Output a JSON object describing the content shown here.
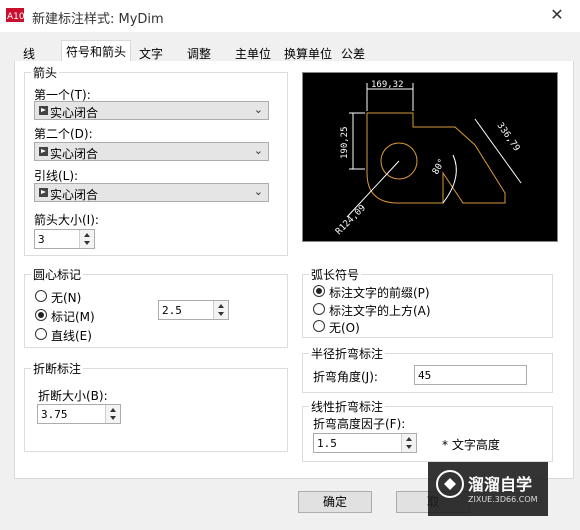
{
  "window": {
    "title": "新建标注样式: MyDim",
    "app_icon_label": "A10"
  },
  "tabs": [
    {
      "label": "线"
    },
    {
      "label": "符号和箭头"
    },
    {
      "label": "文字"
    },
    {
      "label": "调整"
    },
    {
      "label": "主单位"
    },
    {
      "label": "换算单位"
    },
    {
      "label": "公差"
    }
  ],
  "arrows": {
    "group_label": "箭头",
    "first_label": "第一个(T):",
    "first_value": "实心闭合",
    "second_label": "第二个(D):",
    "second_value": "实心闭合",
    "leader_label": "引线(L):",
    "leader_value": "实心闭合",
    "size_label": "箭头大小(I):",
    "size_value": "3"
  },
  "center_marks": {
    "group_label": "圆心标记",
    "none_label": "无(N)",
    "mark_label": "标记(M)",
    "line_label": "直线(E)",
    "size_value": "2.5"
  },
  "break": {
    "group_label": "折断标注",
    "size_label": "折断大小(B):",
    "size_value": "3.75"
  },
  "arc_length": {
    "group_label": "弧长符号",
    "prefix_label": "标注文字的前缀(P)",
    "above_label": "标注文字的上方(A)",
    "none_label": "无(O)"
  },
  "radius_jog": {
    "group_label": "半径折弯标注",
    "angle_label": "折弯角度(J):",
    "angle_value": "45"
  },
  "linear_jog": {
    "group_label": "线性折弯标注",
    "factor_label": "折弯高度因子(F):",
    "factor_value": "1.5",
    "unit_label": "* 文字高度"
  },
  "preview": {
    "dim_top": "169,32",
    "dim_left": "190,25",
    "dim_right": "336,79",
    "dim_angle": "80°",
    "dim_radius": "R124,09"
  },
  "buttons": {
    "ok": "确定",
    "cancel": "取"
  },
  "watermark": {
    "brand": "溜溜自学",
    "url": "ZIXUE.3D66.COM"
  },
  "colors": {
    "preview_bg": "#000000",
    "preview_geometry": "#d89a3a",
    "preview_dims": "#ffffff"
  }
}
